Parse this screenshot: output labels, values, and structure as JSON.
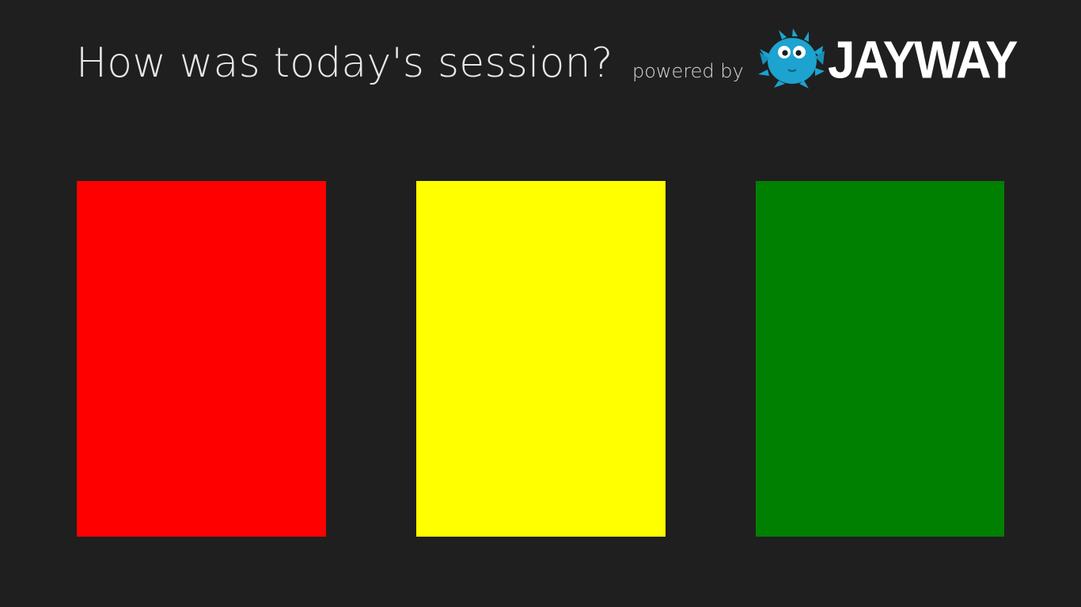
{
  "header": {
    "title": "How was today's session?",
    "powered_by": "powered by",
    "logo_text": "JAYWAY"
  },
  "colors": {
    "background": "#1f1f1f",
    "logo_fish": "#1da3cf"
  },
  "rating_cards": [
    {
      "name": "red",
      "color": "#ff0000"
    },
    {
      "name": "yellow",
      "color": "#ffff00"
    },
    {
      "name": "green",
      "color": "#008000"
    }
  ]
}
